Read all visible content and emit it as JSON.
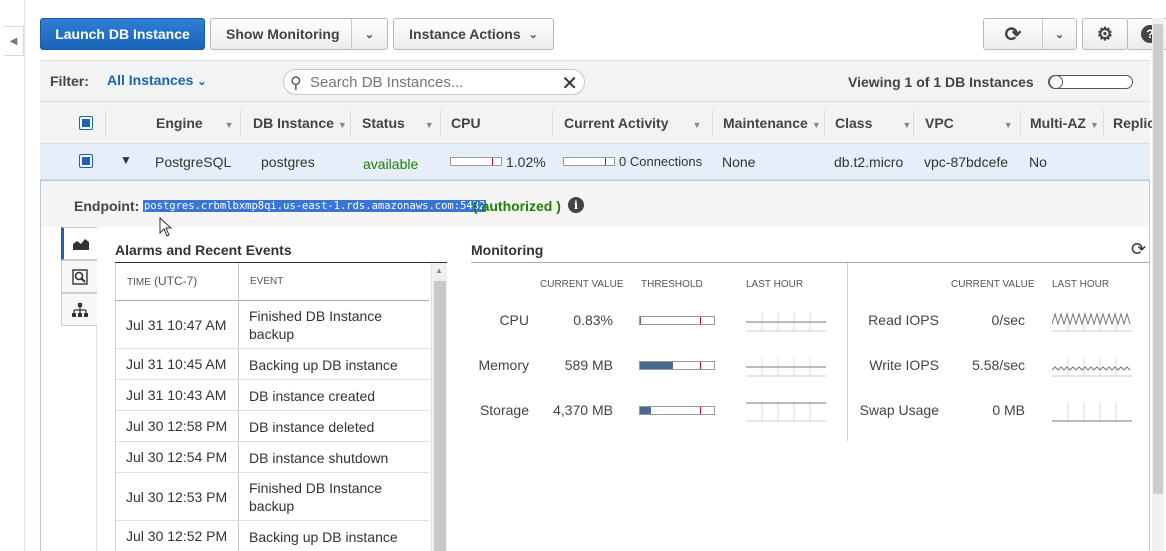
{
  "toolbar": {
    "launch_label": "Launch DB Instance",
    "monitoring_label": "Show Monitoring",
    "actions_label": "Instance Actions"
  },
  "filter": {
    "label": "Filter:",
    "value": "All Instances",
    "search_placeholder": "Search DB Instances...",
    "viewing": "Viewing 1 of 1 DB Instances"
  },
  "columns": [
    "Engine",
    "DB Instance",
    "Status",
    "CPU",
    "Current Activity",
    "Maintenance",
    "Class",
    "VPC",
    "Multi-AZ",
    "Replic"
  ],
  "instance": {
    "engine": "PostgreSQL",
    "name": "postgres",
    "status": "available",
    "cpu": "1.02%",
    "cpu_fraction": 0.03,
    "activity": "0 Connections",
    "maintenance": "None",
    "class": "db.t2.micro",
    "vpc": "vpc-87bdcefe",
    "multi_az": "No"
  },
  "endpoint": {
    "label": "Endpoint:",
    "value": "postgres.crbmlbxmp8qi.us-east-1.rds.amazonaws.com:5432",
    "status_open": "(",
    "status": "authorized",
    "status_close": ")"
  },
  "events": {
    "title": "Alarms and Recent Events",
    "time_header_a": "TIME",
    "time_header_b": "(UTC-7)",
    "event_header": "EVENT",
    "rows": [
      {
        "time": "Jul 31 10:47 AM",
        "event": "Finished DB Instance backup"
      },
      {
        "time": "Jul 31 10:45 AM",
        "event": "Backing up DB instance"
      },
      {
        "time": "Jul 31 10:43 AM",
        "event": "DB instance created"
      },
      {
        "time": "Jul 30 12:58 PM",
        "event": "DB instance deleted"
      },
      {
        "time": "Jul 30 12:54 PM",
        "event": "DB instance shutdown"
      },
      {
        "time": "Jul 30 12:53 PM",
        "event": "Finished DB Instance backup"
      },
      {
        "time": "Jul 30 12:52 PM",
        "event": "Backing up DB instance"
      }
    ]
  },
  "monitoring": {
    "title": "Monitoring",
    "headers": {
      "current_value": "CURRENT VALUE",
      "threshold": "THRESHOLD",
      "last_hour": "LAST HOUR"
    },
    "left": [
      {
        "label": "CPU",
        "value": "0.83%",
        "fraction": 0.01
      },
      {
        "label": "Memory",
        "value": "589 MB",
        "fraction": 0.45
      },
      {
        "label": "Storage",
        "value": "4,370 MB",
        "fraction": 0.15
      }
    ],
    "right": [
      {
        "label": "Read IOPS",
        "value": "0/sec"
      },
      {
        "label": "Write IOPS",
        "value": "5.58/sec"
      },
      {
        "label": "Swap Usage",
        "value": "0 MB"
      }
    ]
  }
}
